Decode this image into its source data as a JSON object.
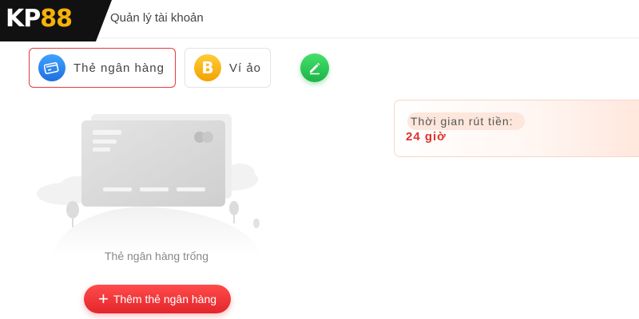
{
  "header": {
    "logo_text": "KP88",
    "title": "Quản lý tài khoản"
  },
  "tabs": [
    {
      "label": "Thẻ ngân hàng",
      "icon": "bank-card-icon",
      "active": true
    },
    {
      "label": "Ví ảo",
      "icon": "bitcoin-icon",
      "icon_glyph": "B",
      "active": false
    }
  ],
  "edit": {
    "icon": "pencil-icon"
  },
  "empty_state": {
    "text": "Thẻ ngân hàng trống",
    "illustration": "empty-bank-card-illustration"
  },
  "add_button": {
    "label": "Thêm thẻ ngân hàng",
    "icon": "plus-icon",
    "glyph": "+"
  },
  "withdraw_info": {
    "label": "Thời gian rút tiền:",
    "value": "24 giờ"
  },
  "colors": {
    "accent_red": "#e53b3b",
    "logo_black": "#111111",
    "logo_gold": "#f6b10a",
    "edit_green": "#2bc855"
  }
}
